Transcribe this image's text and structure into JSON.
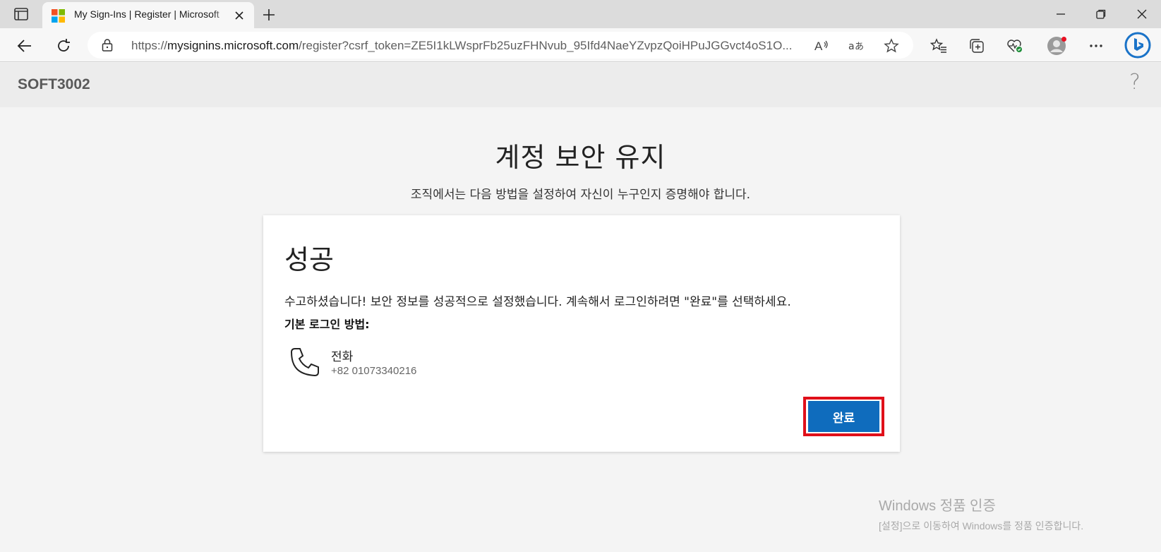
{
  "browser": {
    "tab": {
      "title": "My Sign-Ins | Register | Microsoft"
    },
    "address_bar": {
      "url_prefix": "https://",
      "url_host": "mysignins.microsoft.com",
      "url_rest": "/register?csrf_token=ZE5I1kLWsprFb25uzFHNvub_95Ifd4NaeYZvpzQoiHPuJGGvct4oS1O..."
    }
  },
  "header": {
    "org_name": "SOFT3002",
    "help_label": "?"
  },
  "main": {
    "title": "계정 보안 유지",
    "subtitle": "조직에서는 다음 방법을 설정하여 자신이 누구인지 증명해야 합니다.",
    "card": {
      "title": "성공",
      "message": "수고하셨습니다! 보안 정보를 성공적으로 설정했습니다. 계속해서 로그인하려면 \"완료\"를 선택하세요.",
      "default_method_label": "기본 로그인 방법:",
      "method": {
        "name": "전화",
        "value": "+82 01073340216",
        "icon": "phone-icon"
      },
      "done_label": "완료"
    }
  },
  "watermark": {
    "line1": "Windows 정품 인증",
    "line2": "[설정]으로 이동하여 Windows를 정품 인증합니다."
  },
  "colors": {
    "primary_button": "#0f6cbd",
    "highlight_border": "#e0101a"
  }
}
